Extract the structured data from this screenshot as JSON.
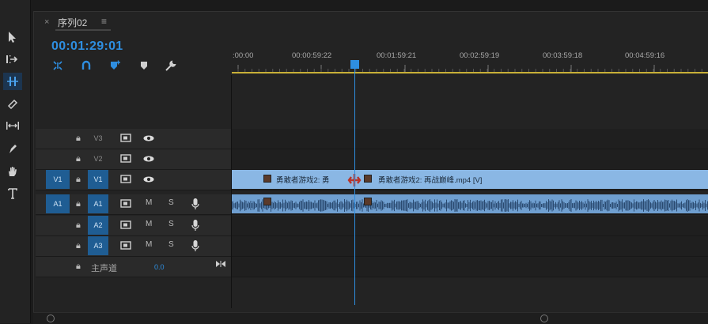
{
  "tab": {
    "close": "×",
    "title": "序列02",
    "menu": "≡"
  },
  "timecode": "00:01:29:01",
  "ruler": {
    "labels": [
      ":00:00",
      "00:00:59:22",
      "00:01:59:21",
      "00:02:59:19",
      "00:03:59:18",
      "00:04:59:16"
    ]
  },
  "tracks": {
    "v3": {
      "name": "V3"
    },
    "v2": {
      "name": "V2"
    },
    "v1": {
      "source": "V1",
      "name": "V1"
    },
    "a1": {
      "source": "A1",
      "name": "A1",
      "m": "M",
      "s": "S"
    },
    "a2": {
      "name": "A2",
      "m": "M",
      "s": "S"
    },
    "a3": {
      "name": "A3",
      "m": "M",
      "s": "S"
    }
  },
  "master": {
    "label": "主声道",
    "value": "0.0"
  },
  "clips": {
    "v1_left_text": "勇敢者游戏2: 勇",
    "v1_right_text": "勇敢者游戏2: 再战巅峰.mp4 [V]"
  },
  "colors": {
    "accent": "#2e8ee0",
    "video_clip": "#8ab7e4",
    "audio_clip": "#6f9fd0",
    "work_area": "#c8b038"
  },
  "icons": {
    "tools": [
      "selection-arrow-icon",
      "track-select-forward-icon",
      "ripple-edit-icon",
      "razor-icon",
      "slip-icon",
      "pen-icon",
      "hand-icon",
      "type-icon"
    ],
    "header": [
      "snap-in-sequence-icon",
      "magnet-link-icon",
      "add-marker-icon",
      "marker-icon",
      "wrench-icon"
    ]
  }
}
